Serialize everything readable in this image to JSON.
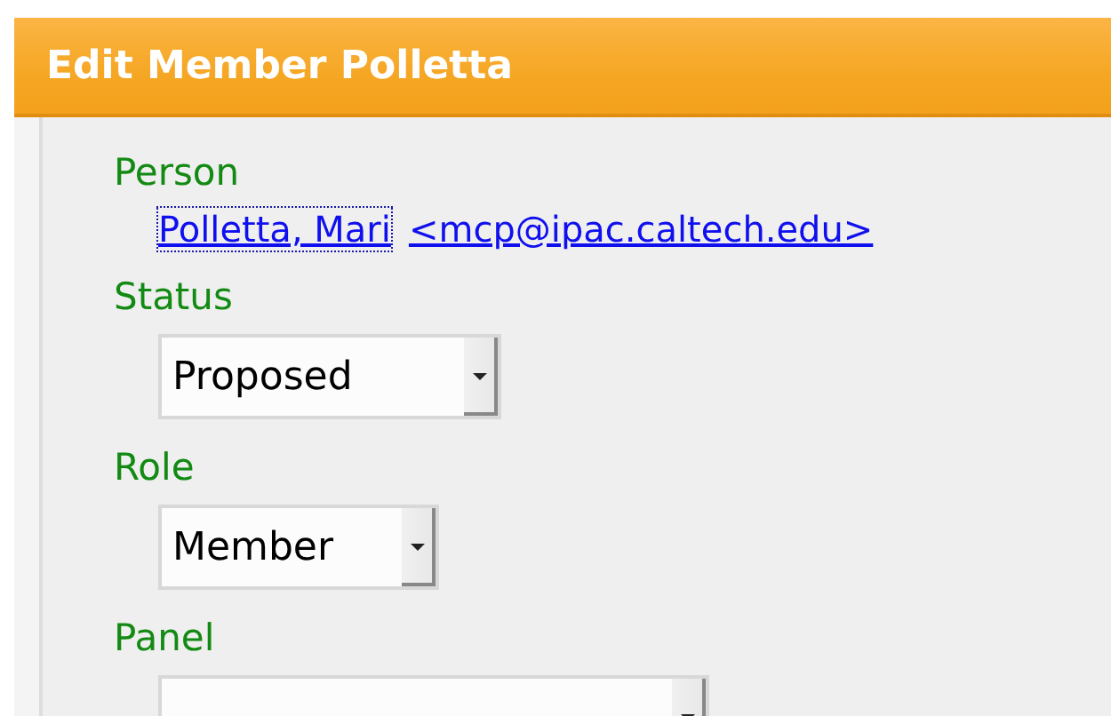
{
  "header": {
    "title": "Edit Member Polletta"
  },
  "fields": [
    {
      "label": "Person",
      "kind": "links",
      "links": [
        {
          "text": "Polletta, Mari",
          "focused": true
        },
        {
          "text": "<mcp@ipac.caltech.edu>",
          "focused": false
        }
      ]
    },
    {
      "label": "Status",
      "kind": "dropdown",
      "value": "Proposed"
    },
    {
      "label": "Role",
      "kind": "dropdown",
      "value": "Member"
    },
    {
      "label": "Panel",
      "kind": "dropdown"
    }
  ]
}
